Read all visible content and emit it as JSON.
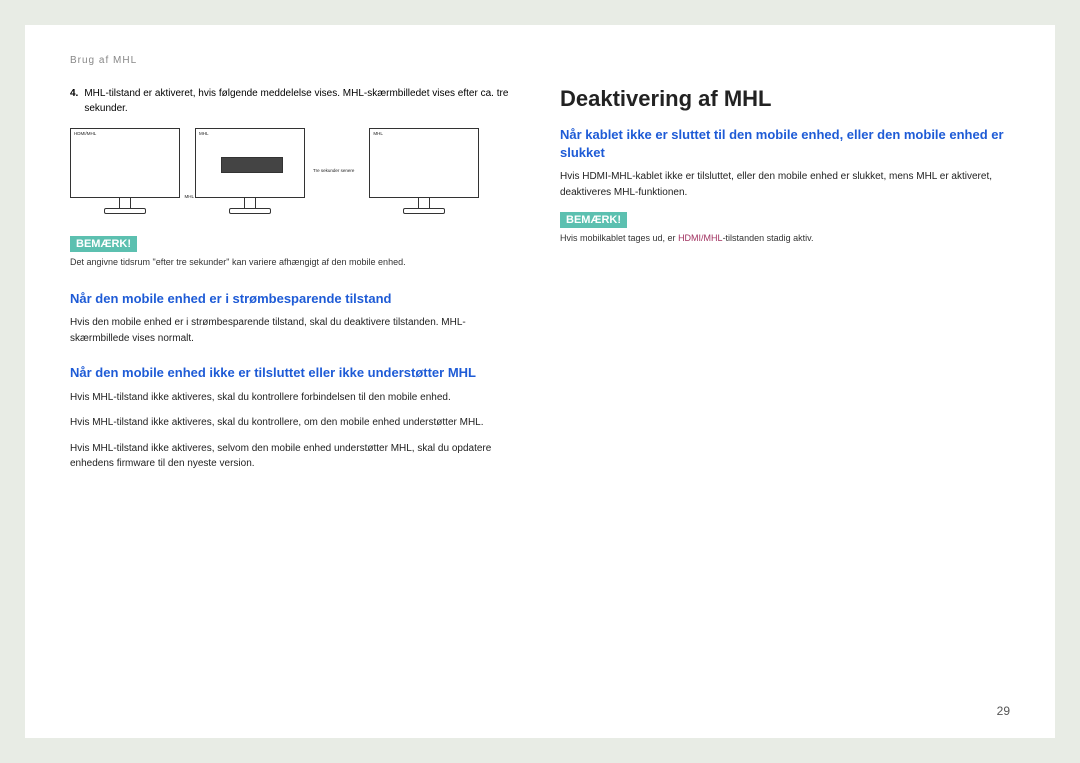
{
  "header": {
    "title": "Brug af MHL"
  },
  "left": {
    "step_num": "4.",
    "step_text": "MHL-tilstand er aktiveret, hvis følgende meddelelse vises. MHL-skærmbilledet vises efter ca. tre sekunder.",
    "monitor1_port": "HDMI/MHL",
    "monitor1_arrow": "MHL",
    "monitor2_port": "MHL",
    "timer_label": "Tre sekunder senere",
    "monitor3_port": "MHL",
    "note_badge": "BEMÆRK!",
    "note_text": "Det angivne tidsrum \"efter tre sekunder\" kan variere afhængigt af den mobile enhed.",
    "sub1_title": "Når den mobile enhed er i strømbesparende tilstand",
    "sub1_p1": "Hvis den mobile enhed er i strømbesparende tilstand, skal du deaktivere tilstanden. MHL-skærmbillede vises normalt.",
    "sub2_title": "Når den mobile enhed ikke er tilsluttet eller ikke understøtter MHL",
    "sub2_p1": "Hvis MHL-tilstand ikke aktiveres, skal du kontrollere forbindelsen til den mobile enhed.",
    "sub2_p2": "Hvis MHL-tilstand ikke aktiveres, skal du kontrollere, om den mobile enhed understøtter MHL.",
    "sub2_p3": "Hvis MHL-tilstand ikke aktiveres, selvom den mobile enhed understøtter MHL, skal du opdatere enhedens firmware til den nyeste version."
  },
  "right": {
    "heading": "Deaktivering af MHL",
    "sub1_title": "Når kablet ikke er sluttet til den mobile enhed, eller den mobile enhed er slukket",
    "sub1_p1": "Hvis HDMI-MHL-kablet ikke er tilsluttet, eller den mobile enhed er slukket, mens MHL er aktiveret, deaktiveres MHL-funktionen.",
    "note_badge": "BEMÆRK!",
    "note_pre": "Hvis mobilkablet tages ud, er ",
    "note_hl": "HDMI/MHL",
    "note_post": "-tilstanden stadig aktiv."
  },
  "page_number": "29"
}
